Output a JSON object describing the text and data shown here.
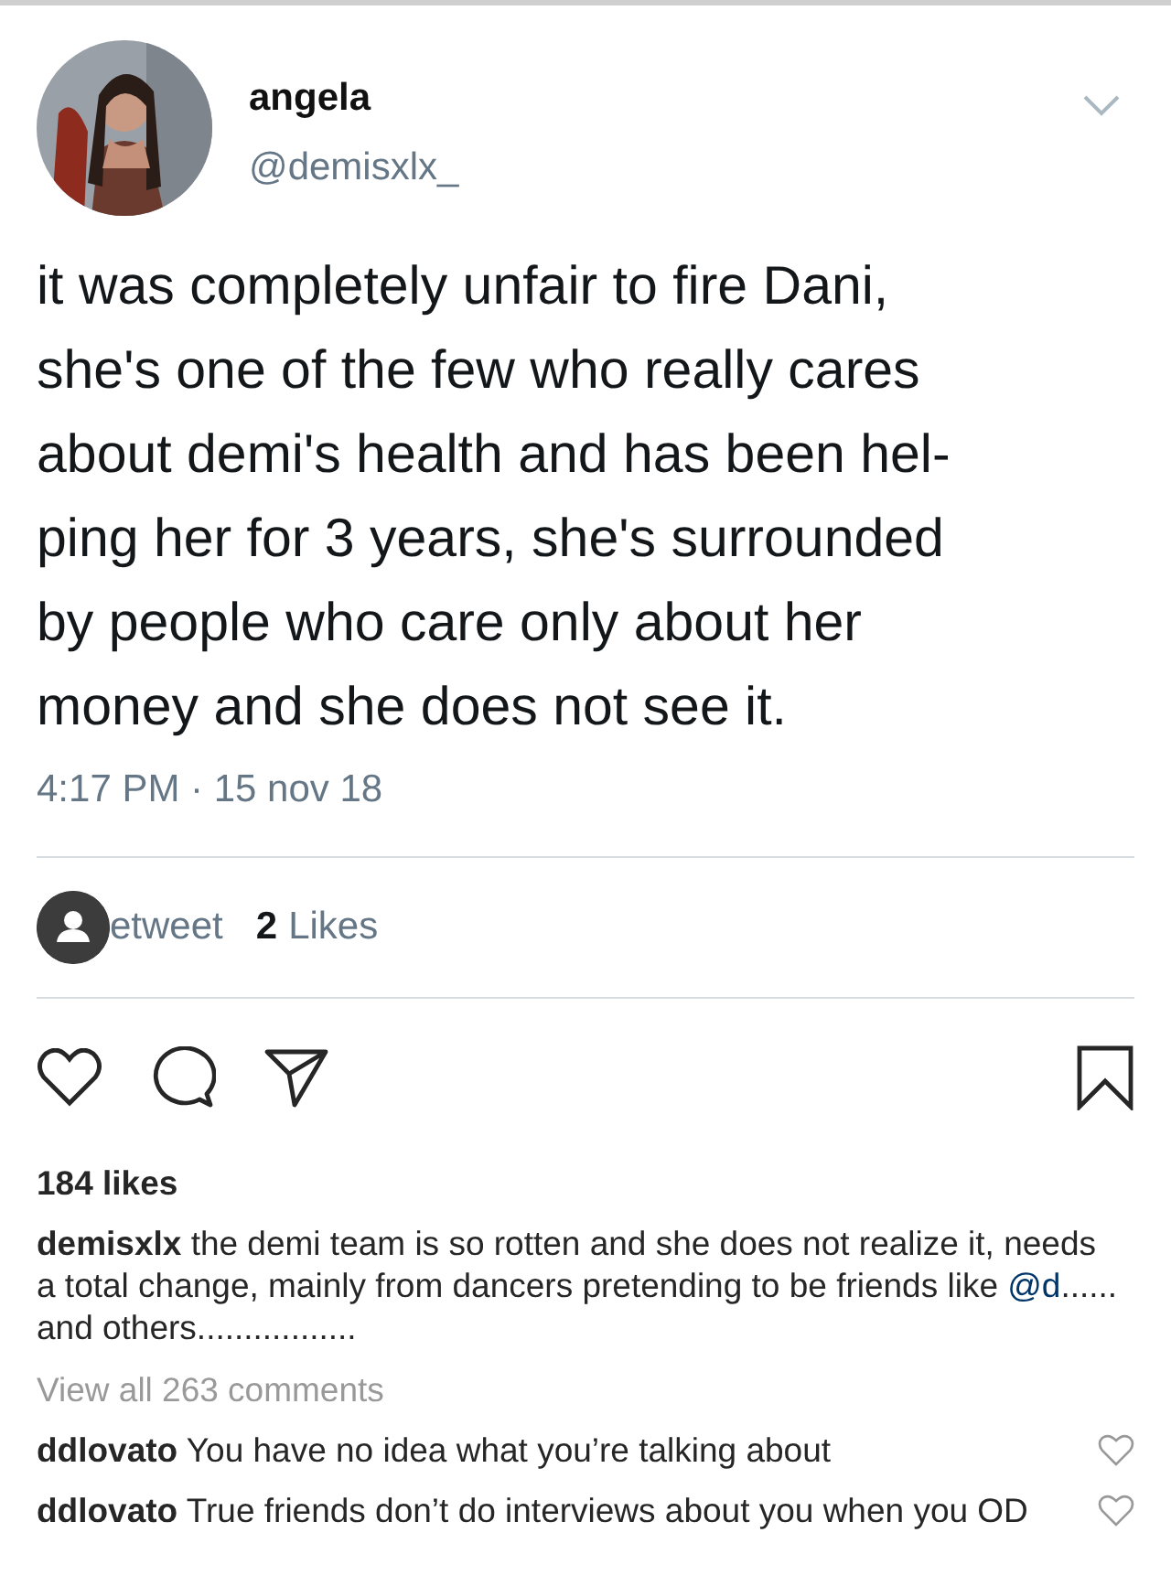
{
  "tweet": {
    "author": {
      "name": "angela",
      "handle": "@demisxlx_"
    },
    "text_lines": [
      "it was completely unfair to fire Dani,",
      "she's one of the few who really cares",
      "about demi's health and has been hel-",
      "ping her for 3 years, she's surrounded",
      "by people who care only about her",
      "money and she does not see it."
    ],
    "timestamp": "4:17 PM · 15 nov 18",
    "retweets_label": "etweet",
    "likes_count": "2",
    "likes_label": "Likes"
  },
  "post": {
    "likes": "184 likes",
    "caption": {
      "user": "demisxlx",
      "text": "the demi team is so rotten and she does not realize it, needs a total change, mainly from dancers pretending to be friends like",
      "mention": "@d",
      "rest": "...... and others................."
    },
    "view_all": "View all 263 comments",
    "comments": [
      {
        "user": "ddlovato",
        "text": "You have no idea what you’re talking about",
        "liked": false
      },
      {
        "user": "ddlovato",
        "text": "True friends don’t do interviews about you when you OD",
        "liked": false
      }
    ]
  }
}
